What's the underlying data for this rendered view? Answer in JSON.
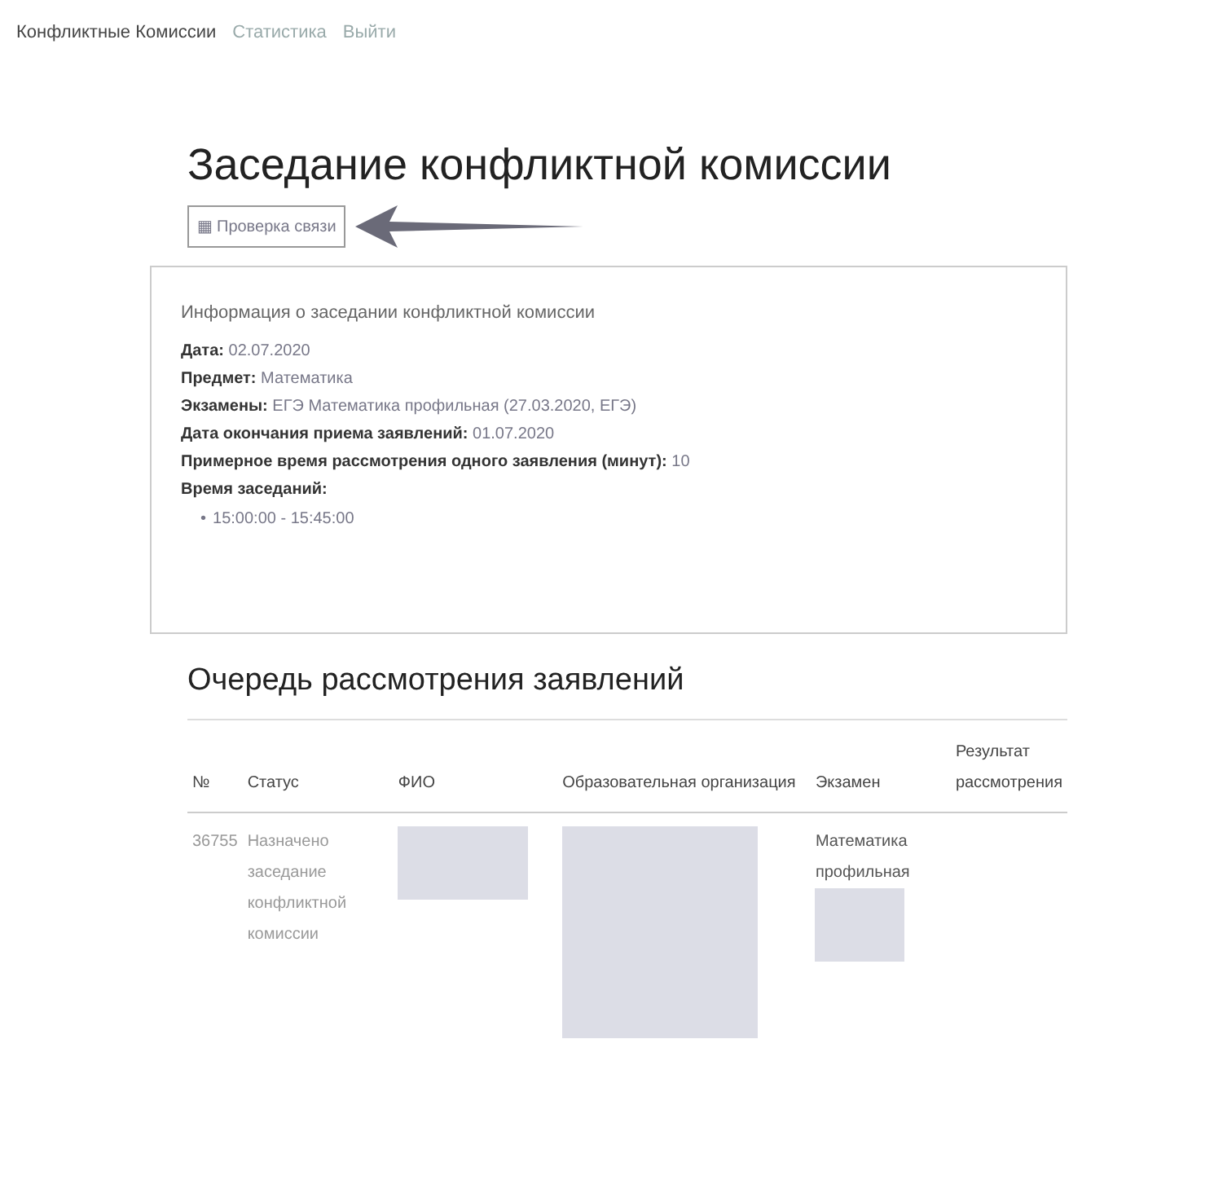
{
  "navbar": {
    "brand": "Конфликтные Комиссии",
    "links": [
      "Статистика",
      "Выйти"
    ]
  },
  "page": {
    "title": "Заседание конфликтной комиссии",
    "button": {
      "icon": "▦",
      "label": "Проверка связи"
    },
    "annotation": {
      "kind": "arrow"
    }
  },
  "info_panel": {
    "heading": "Информация о заседании конфликтной комиссии",
    "fields": [
      {
        "label": "Дата:",
        "value": "02.07.2020"
      },
      {
        "label": "Предмет:",
        "value": "Математика"
      },
      {
        "label": "Экзамены:",
        "value": "ЕГЭ Математика профильная (27.03.2020, ЕГЭ)"
      },
      {
        "label": "Дата окончания приема заявлений:",
        "value": "01.07.2020"
      },
      {
        "label": "Примерное время рассмотрения одного заявления (минут):",
        "value": "10"
      },
      {
        "label": "Время заседаний:"
      }
    ],
    "times": [
      {
        "marker": "•",
        "text": "15:00:00 - 15:45:00"
      }
    ]
  },
  "queue": {
    "title": "Очередь рассмотрения заявлений",
    "columns": [
      "№",
      "Статус",
      "ФИО",
      "Образовательная организация",
      "Экзамен",
      "Результат рассмотрения"
    ],
    "rows": [
      {
        "cells": [
          {
            "text": "36755"
          },
          {
            "text": "Назначено заседание конфликтной комиссии"
          },
          {
            "redacted": true
          },
          {
            "redacted": true
          },
          {
            "text": "Математика профильная",
            "redacted": true
          },
          {}
        ]
      }
    ]
  }
}
